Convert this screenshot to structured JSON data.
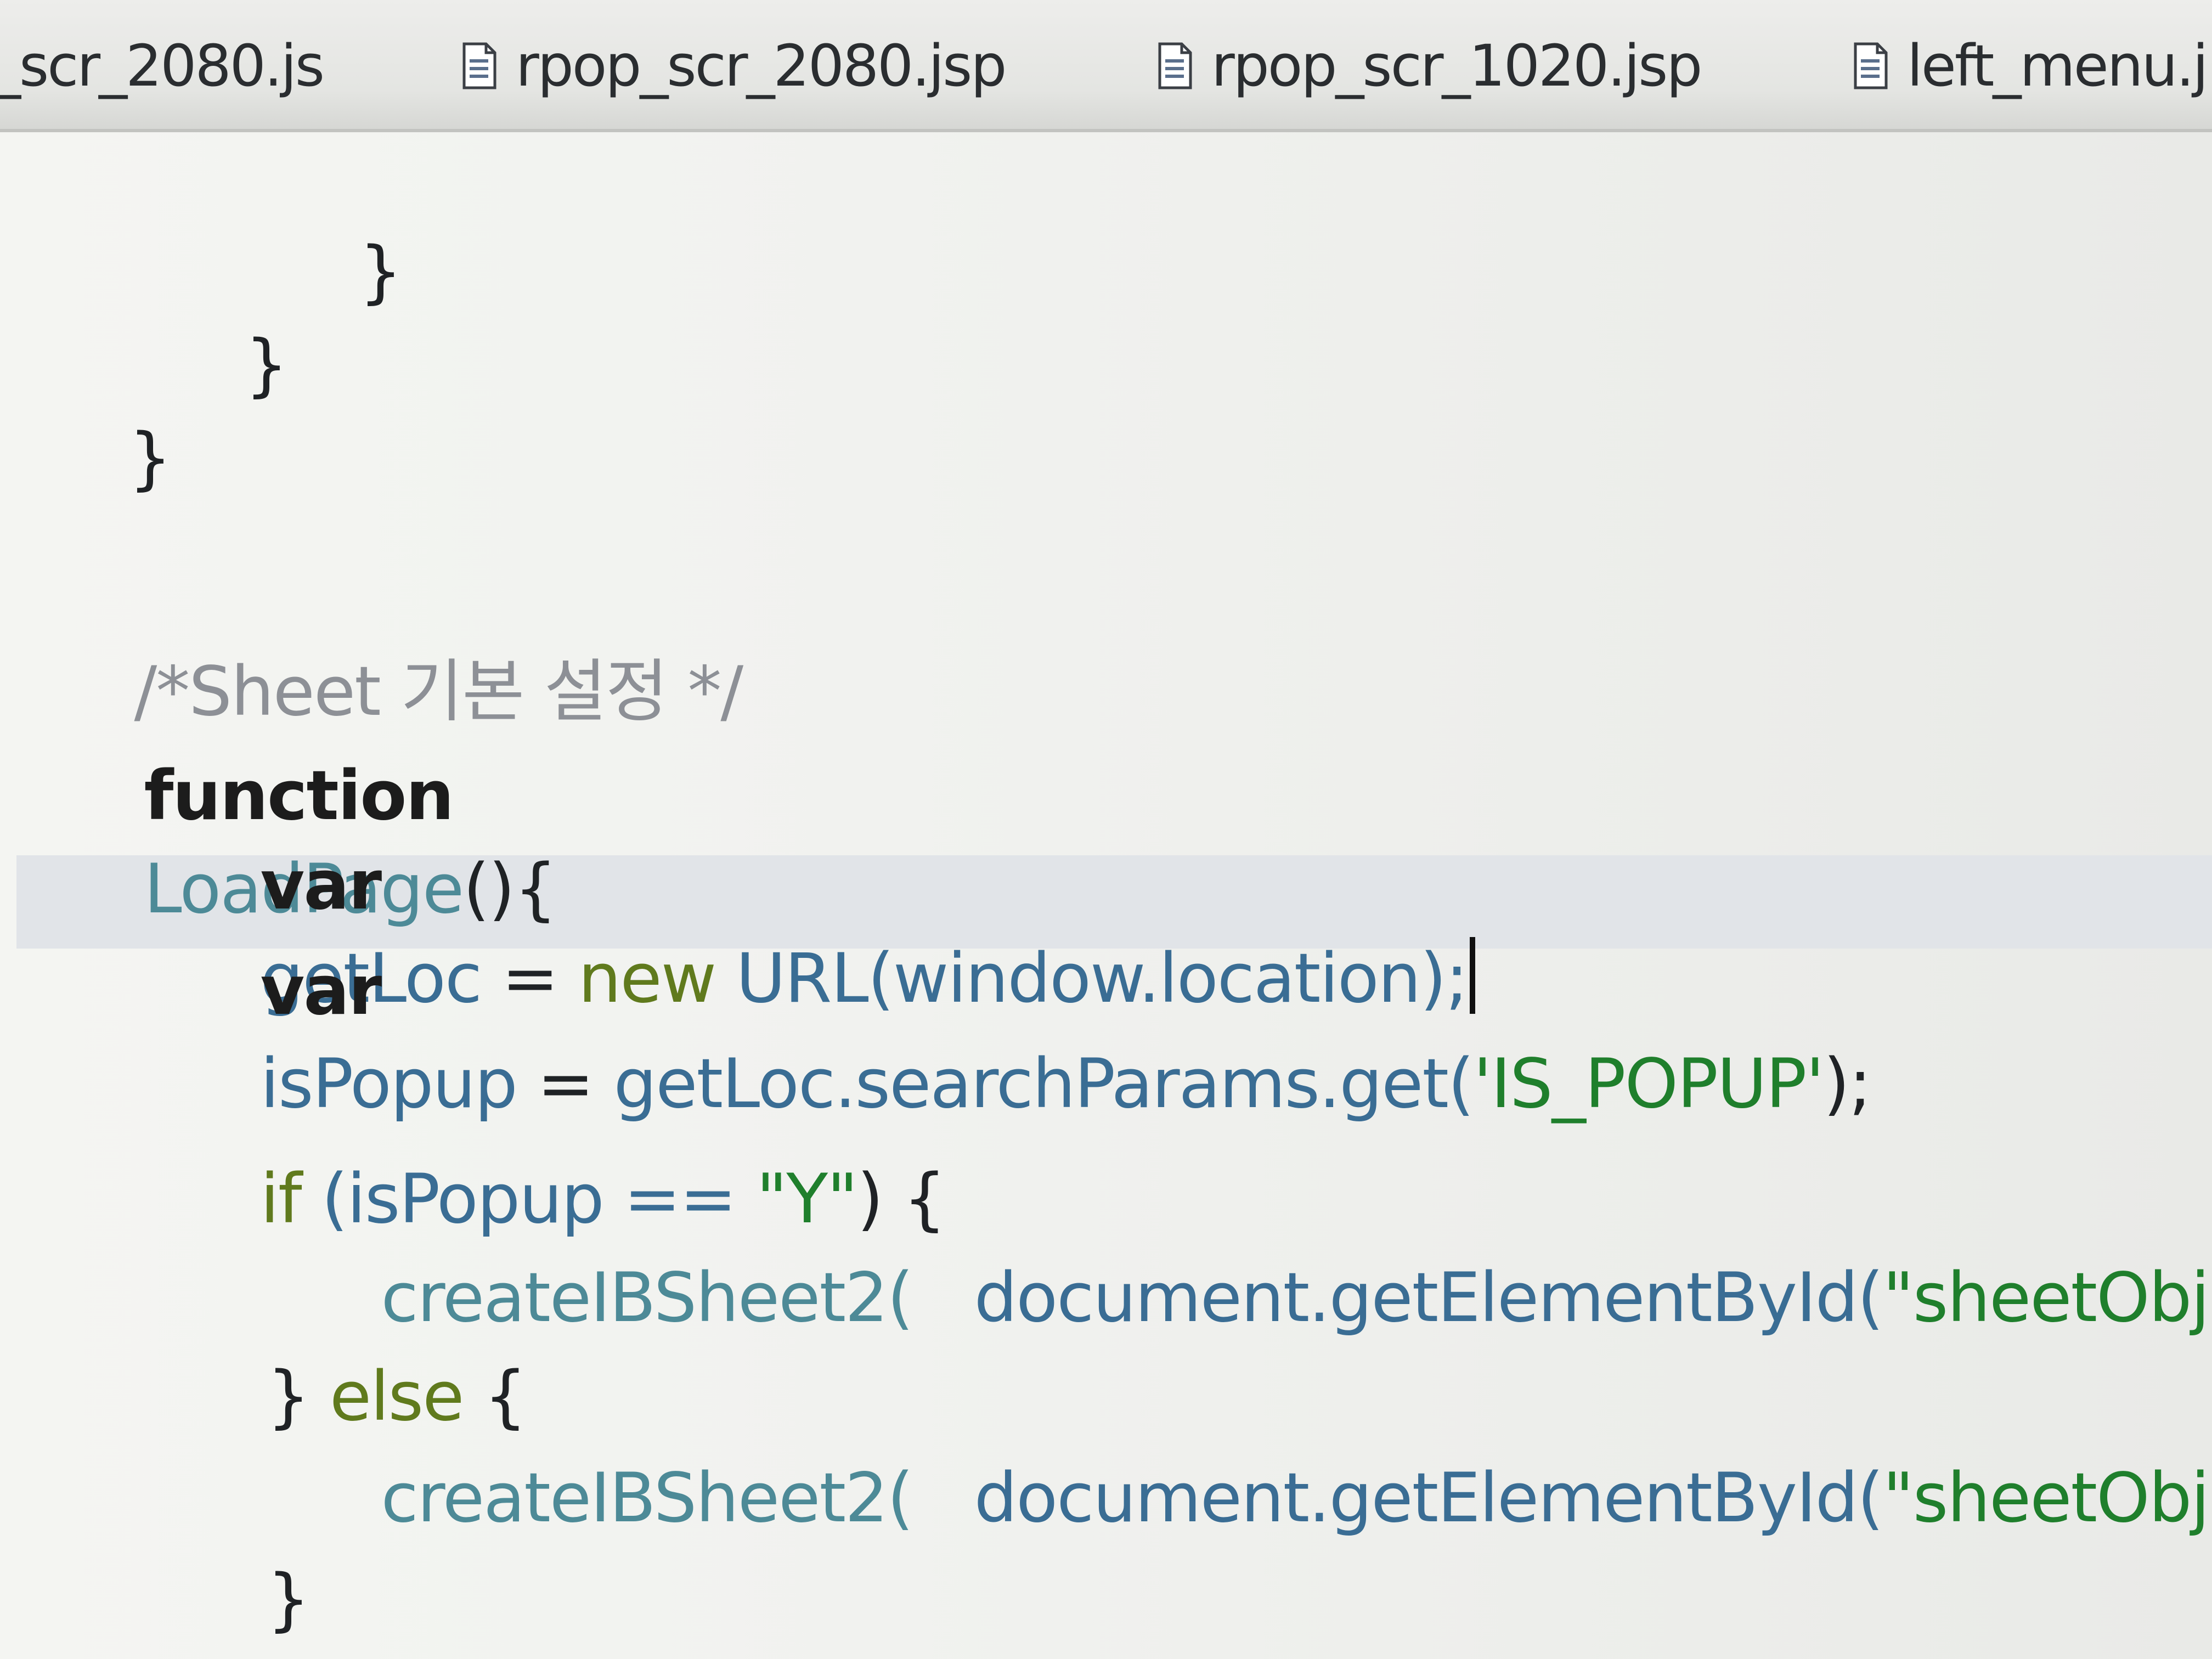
{
  "tabs": [
    {
      "label": "_scr_2080.js",
      "icon": "none"
    },
    {
      "label": "rpop_scr_2080.jsp",
      "icon": "jsp-file-icon"
    },
    {
      "label": "rpop_scr_1020.jsp",
      "icon": "jsp-file-icon"
    },
    {
      "label": "left_menu.j",
      "icon": "jsp-file-icon"
    }
  ],
  "code": {
    "line1": {
      "brace": "}"
    },
    "line2": {
      "brace": "}"
    },
    "line3": {
      "brace": "}"
    },
    "comment": "/*Sheet 기본 설정 */",
    "func": {
      "keyword": "function",
      "name": "LoadPage",
      "tail": "(){"
    },
    "varGetLoc": {
      "keyword": "var",
      "name": "getLoc",
      "eq": " = ",
      "new": "new",
      "call": " URL(window.location);"
    },
    "varIsPopup": {
      "keyword": "var",
      "name": "isPopup",
      "eq": " = ",
      "call": "getLoc.searchParams.get(",
      "str": "'IS_POPUP'",
      "tail": ");"
    },
    "ifLine": {
      "keyword": "if",
      "cond": " (isPopup == ",
      "str": "\"Y\"",
      "tail": ") {"
    },
    "call1": {
      "name": "createIBSheet2(",
      "arg": "   document.getElementById(",
      "str": "\"sheetObj\"",
      "tail": "),"
    },
    "elseLine": {
      "open": "} ",
      "keyword": "else",
      "tail": " {"
    },
    "call2": {
      "name": "createIBSheet2(",
      "arg": "   document.getElementById(",
      "str": "\"sheetObj\"",
      "tail": "),"
    },
    "closeBrace": "}"
  },
  "colors": {
    "keyword": "#1c1c1c",
    "function_name": "#4d8a97",
    "identifier": "#3a6d94",
    "flow_keyword": "#607a1d",
    "string": "#1f7f2c",
    "comment": "#8d9096",
    "current_line_highlight": "#e1e4e8"
  }
}
